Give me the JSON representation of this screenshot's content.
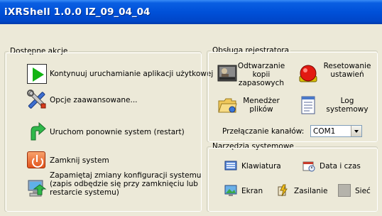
{
  "window": {
    "app_name": "iXRShell 1.0.0",
    "build_id": "IZ_09_04_04"
  },
  "actions_group": {
    "title": "Dostępne akcje",
    "items": [
      {
        "label": "Kontynuuj uruchamianie aplikacji użytkowej",
        "icon": "play-icon"
      },
      {
        "label": "Opcje zaawansowane...",
        "icon": "tools-icon"
      },
      {
        "label": "Uruchom ponownie system (restart)",
        "icon": "restart-arrow-icon"
      },
      {
        "label": "Zamknij system",
        "icon": "power-icon"
      },
      {
        "label_lines": [
          "Zapamiętaj zmiany konfiguracji systemu",
          "(zapis odbędzie się przy zamknięciu lub",
          "restarcie systemu)"
        ],
        "icon": "save-computer-icon"
      }
    ]
  },
  "registry_group": {
    "title": "Obsługa rejestratora",
    "playback": {
      "lines": [
        "Odtwarzanie",
        "kopii",
        "zapasowych"
      ],
      "icon": "video-playback-icon"
    },
    "reset": {
      "lines": [
        "Resetowanie",
        "ustawień"
      ],
      "icon": "red-alarm-button-icon"
    },
    "file_manager": {
      "lines": [
        "Menedżer",
        "plików"
      ],
      "icon": "folder-icon"
    },
    "system_log": {
      "lines": [
        "Log",
        "systemowy"
      ],
      "icon": "log-notepad-icon"
    },
    "channel_switch": {
      "label": "Przełączanie kanałów:",
      "selected": "COM1"
    }
  },
  "tools_group": {
    "title": "Narzędzia systemowe",
    "keyboard": {
      "label": "Klawiatura",
      "icon": "keyboard-icon"
    },
    "datetime": {
      "label": "Data i czas",
      "icon": "datetime-icon"
    },
    "screen": {
      "label": "Ekran",
      "icon": "display-icon"
    },
    "power": {
      "label": "Zasilanie",
      "icon": "power-supply-icon"
    },
    "network": {
      "label": "Sieć",
      "icon": "network-icon"
    }
  }
}
